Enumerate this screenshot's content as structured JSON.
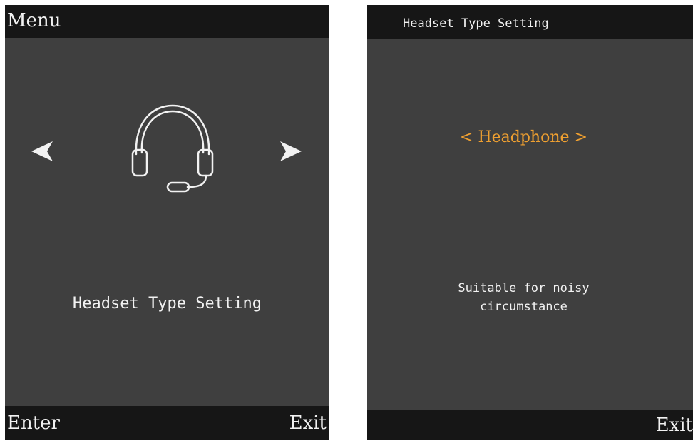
{
  "menu_screen": {
    "title": "Menu",
    "icon": "headset-icon",
    "item_label": "Headset Type Setting",
    "nav": {
      "left_icon": "arrow-left-icon",
      "right_icon": "arrow-right-icon"
    },
    "softkeys": {
      "left": "Enter",
      "right": "Exit"
    }
  },
  "setting_screen": {
    "title": "Headset Type Setting",
    "option_value": "< Headphone >",
    "description_line1": "Suitable for noisy",
    "description_line2": "circumstance",
    "softkeys": {
      "right": "Exit"
    }
  },
  "colors": {
    "screen_bg": "#3f3f3f",
    "bar_bg": "#161616",
    "text": "#f2f2f2",
    "highlight": "#f0a030"
  }
}
